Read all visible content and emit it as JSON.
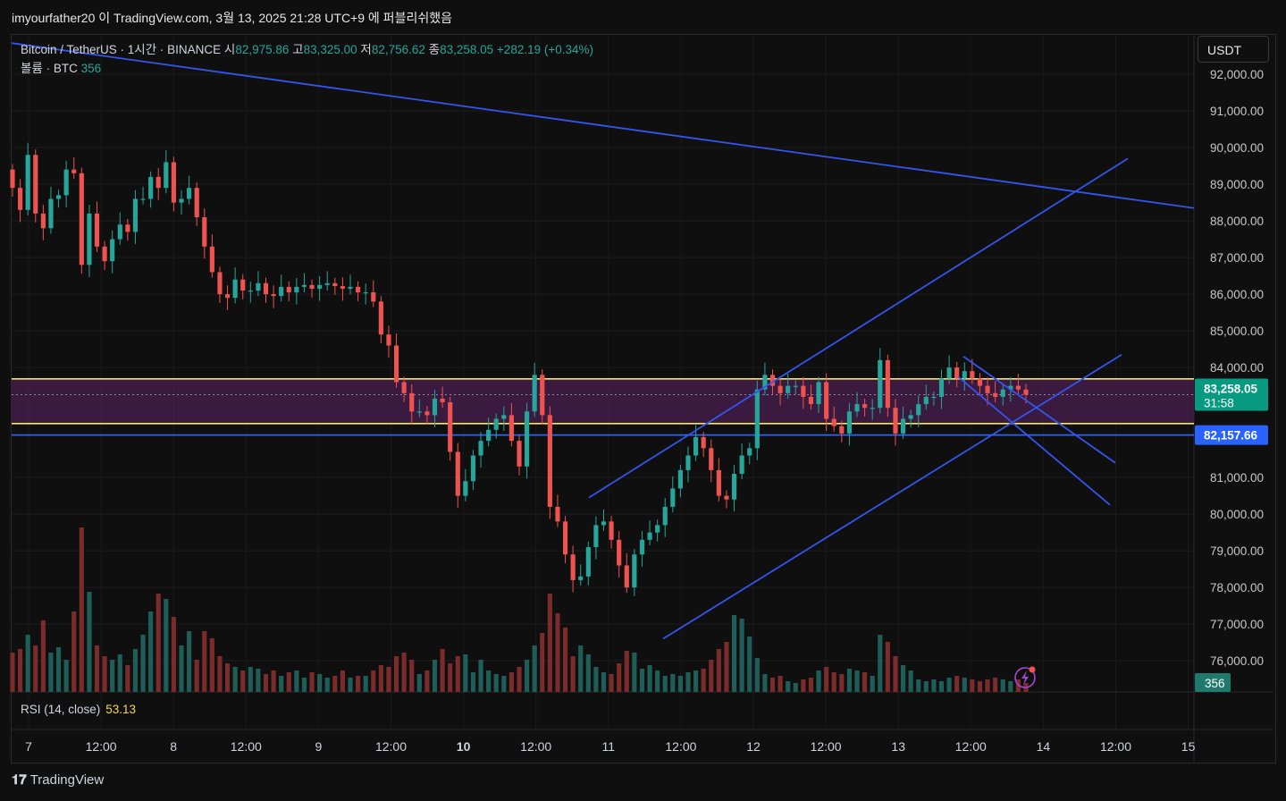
{
  "header": {
    "title": "imyourfather20 이 TradingView.com, 3월 13, 2025 21:28 UTC+9 에 퍼블리쉬했음"
  },
  "legend": {
    "symbol": "Bitcoin / TetherUS · 1시간 · BINANCE",
    "open_label": "시",
    "open": "82,975.86",
    "high_label": "고",
    "high": "83,325.00",
    "low_label": "저",
    "low": "82,756.62",
    "close_label": "종",
    "close": "83,258.05",
    "change": "+282.19 (+0.34%)",
    "volume_label": "볼륨 · BTC",
    "volume": "356"
  },
  "rsi": {
    "label": "RSI (14, close)",
    "value": "53.13"
  },
  "currency_button": "USDT",
  "footer": {
    "brand": "TradingView"
  },
  "chart_data": {
    "type": "candlestick",
    "symbol": "BTCUSDT",
    "interval": "1h",
    "price_ticks": [
      "92,000.00",
      "91,000.00",
      "90,000.00",
      "89,000.00",
      "88,000.00",
      "87,000.00",
      "86,000.00",
      "85,000.00",
      "84,000.00",
      "81,000.00",
      "80,000.00",
      "79,000.00",
      "78,000.00",
      "77,000.00",
      "76,000.00"
    ],
    "ylim": [
      75150,
      93050
    ],
    "time_ticks": [
      "7",
      "12:00",
      "8",
      "12:00",
      "9",
      "12:00",
      "10",
      "12:00",
      "11",
      "12:00",
      "12",
      "12:00",
      "13",
      "12:00",
      "14",
      "12:00",
      "15"
    ],
    "bold_ticks": [
      "10"
    ],
    "last_price": {
      "value": "83,258.05",
      "countdown": "31:58",
      "price": 83258.05
    },
    "marked_price": {
      "value": "82,157.66",
      "price": 82157.66
    },
    "volume_badge": "356",
    "zone": {
      "top": 83690,
      "bottom": 82470
    },
    "dotted_level": 83258,
    "closes": [
      88900,
      88300,
      89800,
      88200,
      87800,
      88600,
      88700,
      89400,
      89300,
      86800,
      88200,
      87300,
      86900,
      87500,
      87900,
      87700,
      88600,
      88600,
      89200,
      88900,
      89600,
      88500,
      88600,
      88900,
      88100,
      87300,
      86600,
      86000,
      85900,
      86400,
      86100,
      86100,
      86300,
      86000,
      85950,
      86200,
      86050,
      86200,
      86250,
      86150,
      86250,
      86300,
      86220,
      86150,
      86200,
      86050,
      86050,
      85800,
      84900,
      84600,
      83600,
      83300,
      82800,
      82800,
      82700,
      83150,
      83050,
      81700,
      80500,
      80900,
      81600,
      82000,
      82300,
      82600,
      82700,
      82000,
      81300,
      82800,
      83800,
      82700,
      80200,
      79800,
      78900,
      78200,
      78300,
      79100,
      79700,
      79800,
      79300,
      78600,
      78000,
      78900,
      79300,
      79500,
      79700,
      80200,
      80700,
      81200,
      81600,
      82100,
      81800,
      81200,
      80500,
      80400,
      81100,
      81600,
      81800,
      83400,
      83800,
      83500,
      83300,
      83500,
      83500,
      83200,
      83000,
      83600,
      82600,
      82400,
      82200,
      82800,
      83000,
      82900,
      82900,
      84200,
      82900,
      82200,
      82600,
      82700,
      83000,
      83200,
      83200,
      83700,
      84000,
      83700,
      83900,
      83700,
      83500,
      83300,
      83200,
      83400,
      83500,
      83400,
      83258
    ],
    "volumes": [
      0.22,
      0.24,
      0.32,
      0.26,
      0.4,
      0.22,
      0.25,
      0.18,
      0.45,
      0.92,
      0.56,
      0.26,
      0.2,
      0.18,
      0.21,
      0.15,
      0.24,
      0.32,
      0.45,
      0.55,
      0.52,
      0.42,
      0.26,
      0.34,
      0.18,
      0.34,
      0.3,
      0.2,
      0.16,
      0.14,
      0.12,
      0.14,
      0.13,
      0.1,
      0.12,
      0.09,
      0.11,
      0.12,
      0.08,
      0.11,
      0.1,
      0.08,
      0.09,
      0.12,
      0.08,
      0.09,
      0.09,
      0.12,
      0.15,
      0.14,
      0.2,
      0.22,
      0.18,
      0.1,
      0.12,
      0.18,
      0.24,
      0.16,
      0.2,
      0.21,
      0.11,
      0.18,
      0.12,
      0.1,
      0.09,
      0.11,
      0.14,
      0.18,
      0.26,
      0.33,
      0.55,
      0.44,
      0.36,
      0.2,
      0.26,
      0.21,
      0.14,
      0.11,
      0.1,
      0.16,
      0.23,
      0.22,
      0.13,
      0.15,
      0.12,
      0.09,
      0.1,
      0.09,
      0.11,
      0.12,
      0.13,
      0.18,
      0.24,
      0.28,
      0.43,
      0.41,
      0.31,
      0.19,
      0.1,
      0.08,
      0.09,
      0.06,
      0.05,
      0.07,
      0.08,
      0.12,
      0.14,
      0.11,
      0.1,
      0.13,
      0.12,
      0.11,
      0.09,
      0.32,
      0.28,
      0.2,
      0.15,
      0.12,
      0.07,
      0.06,
      0.07,
      0.06,
      0.08,
      0.09,
      0.08,
      0.07,
      0.06,
      0.07,
      0.08,
      0.07,
      0.06,
      0.07,
      0.05
    ]
  }
}
